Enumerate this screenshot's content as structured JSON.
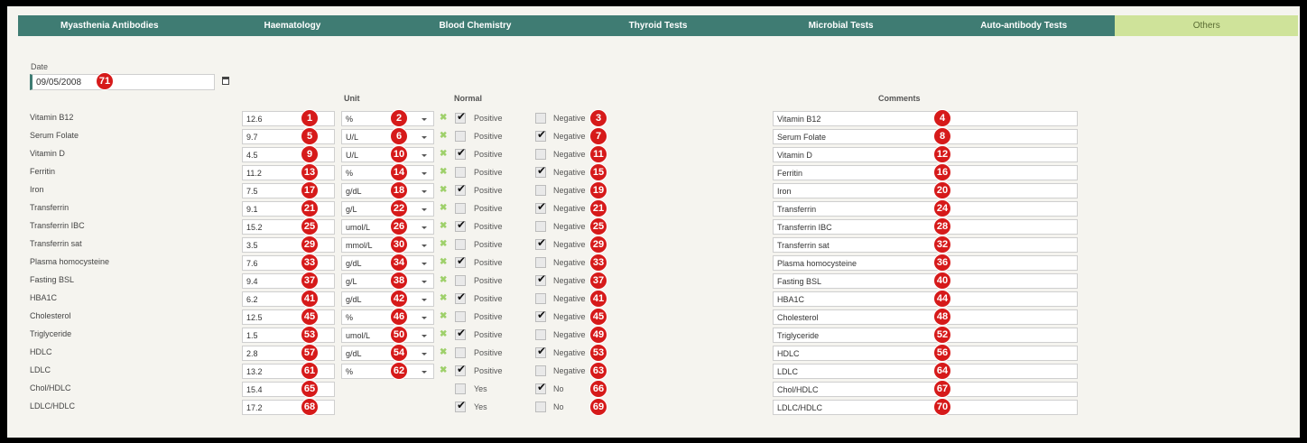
{
  "tabs": [
    "Myasthenia Antibodies",
    "Haematology",
    "Blood Chemistry",
    "Thyroid Tests",
    "Microbial Tests",
    "Auto-antibody Tests",
    "Others"
  ],
  "active_tab": 6,
  "date": {
    "label": "Date",
    "value": "09/05/2008",
    "badge": "71"
  },
  "headers": {
    "unit": "Unit",
    "normal": "Normal",
    "comments": "Comments"
  },
  "rows": [
    {
      "label": "Vitamin B12",
      "value": "12.6",
      "unit": "%",
      "pos_label": "Positive",
      "neg_label": "Negative",
      "pos": true,
      "neg": false,
      "comment": "Vitamin B12",
      "b_val": "1",
      "b_unit": "2",
      "b_cb": "3",
      "b_com": "4"
    },
    {
      "label": "Serum Folate",
      "value": "9.7",
      "unit": "U/L",
      "pos_label": "Positive",
      "neg_label": "Negative",
      "pos": false,
      "neg": true,
      "comment": "Serum Folate",
      "b_val": "5",
      "b_unit": "6",
      "b_cb": "7",
      "b_com": "8"
    },
    {
      "label": "Vitamin D",
      "value": "4.5",
      "unit": "U/L",
      "pos_label": "Positive",
      "neg_label": "Negative",
      "pos": true,
      "neg": false,
      "comment": "Vitamin D",
      "b_val": "9",
      "b_unit": "10",
      "b_cb": "11",
      "b_com": "12"
    },
    {
      "label": "Ferritin",
      "value": "11.2",
      "unit": "%",
      "pos_label": "Positive",
      "neg_label": "Negative",
      "pos": false,
      "neg": true,
      "comment": "Ferritin",
      "b_val": "13",
      "b_unit": "14",
      "b_cb": "15",
      "b_com": "16"
    },
    {
      "label": "Iron",
      "value": "7.5",
      "unit": "g/dL",
      "pos_label": "Positive",
      "neg_label": "Negative",
      "pos": true,
      "neg": false,
      "comment": "Iron",
      "b_val": "17",
      "b_unit": "18",
      "b_cb": "19",
      "b_com": "20"
    },
    {
      "label": "Transferrin",
      "value": "9.1",
      "unit": "g/L",
      "pos_label": "Positive",
      "neg_label": "Negative",
      "pos": false,
      "neg": true,
      "comment": "Transferrin",
      "b_val": "21",
      "b_unit": "22",
      "b_cb": "21",
      "b_com": "24"
    },
    {
      "label": "Transferrin IBC",
      "value": "15.2",
      "unit": "umol/L",
      "pos_label": "Positive",
      "neg_label": "Negative",
      "pos": true,
      "neg": false,
      "comment": "Transferrin IBC",
      "b_val": "25",
      "b_unit": "26",
      "b_cb": "25",
      "b_com": "28"
    },
    {
      "label": "Transferrin sat",
      "value": "3.5",
      "unit": "mmol/L",
      "pos_label": "Positive",
      "neg_label": "Negative",
      "pos": false,
      "neg": true,
      "comment": "Transferrin sat",
      "b_val": "29",
      "b_unit": "30",
      "b_cb": "29",
      "b_com": "32"
    },
    {
      "label": "Plasma homocysteine",
      "value": "7.6",
      "unit": "g/dL",
      "pos_label": "Positive",
      "neg_label": "Negative",
      "pos": true,
      "neg": false,
      "comment": "Plasma homocysteine",
      "b_val": "33",
      "b_unit": "34",
      "b_cb": "33",
      "b_com": "36"
    },
    {
      "label": "Fasting BSL",
      "value": "9.4",
      "unit": "g/L",
      "pos_label": "Positive",
      "neg_label": "Negative",
      "pos": false,
      "neg": true,
      "comment": "Fasting BSL",
      "b_val": "37",
      "b_unit": "38",
      "b_cb": "37",
      "b_com": "40"
    },
    {
      "label": "HBA1C",
      "value": "6.2",
      "unit": "g/dL",
      "pos_label": "Positive",
      "neg_label": "Negative",
      "pos": true,
      "neg": false,
      "comment": "HBA1C",
      "b_val": "41",
      "b_unit": "42",
      "b_cb": "41",
      "b_com": "44"
    },
    {
      "label": "Cholesterol",
      "value": "12.5",
      "unit": "%",
      "pos_label": "Positive",
      "neg_label": "Negative",
      "pos": false,
      "neg": true,
      "comment": "Cholesterol",
      "b_val": "45",
      "b_unit": "46",
      "b_cb": "45",
      "b_com": "48"
    },
    {
      "label": "Triglyceride",
      "value": "1.5",
      "unit": "umol/L",
      "pos_label": "Positive",
      "neg_label": "Negative",
      "pos": true,
      "neg": false,
      "comment": "Triglyceride",
      "b_val": "53",
      "b_unit": "50",
      "b_cb": "49",
      "b_com": "52"
    },
    {
      "label": "HDLC",
      "value": "2.8",
      "unit": "g/dL",
      "pos_label": "Positive",
      "neg_label": "Negative",
      "pos": false,
      "neg": true,
      "comment": "HDLC",
      "b_val": "57",
      "b_unit": "54",
      "b_cb": "53",
      "b_com": "56"
    },
    {
      "label": "LDLC",
      "value": "13.2",
      "unit": "%",
      "pos_label": "Positive",
      "neg_label": "Negative",
      "pos": true,
      "neg": false,
      "comment": "LDLC",
      "b_val": "61",
      "b_unit": "62",
      "b_cb": "63",
      "b_com": "64"
    },
    {
      "label": "Chol/HDLC",
      "value": "15.4",
      "unit": null,
      "pos_label": "Yes",
      "neg_label": "No",
      "pos": false,
      "neg": true,
      "comment": "Chol/HDLC",
      "b_val": "65",
      "b_unit": null,
      "b_cb": "66",
      "b_com": "67"
    },
    {
      "label": "LDLC/HDLC",
      "value": "17.2",
      "unit": null,
      "pos_label": "Yes",
      "neg_label": "No",
      "pos": true,
      "neg": false,
      "comment": "LDLC/HDLC",
      "b_val": "68",
      "b_unit": null,
      "b_cb": "69",
      "b_com": "70"
    }
  ],
  "icons": {
    "clear": "clear-x-icon",
    "calendar": "calendar-icon",
    "dropdown": "chevron-down-icon"
  },
  "colors": {
    "tab": "#3f7c73",
    "tab_active": "#cfe39a",
    "badge": "#d61a1a",
    "clear": "#9ed06a"
  }
}
